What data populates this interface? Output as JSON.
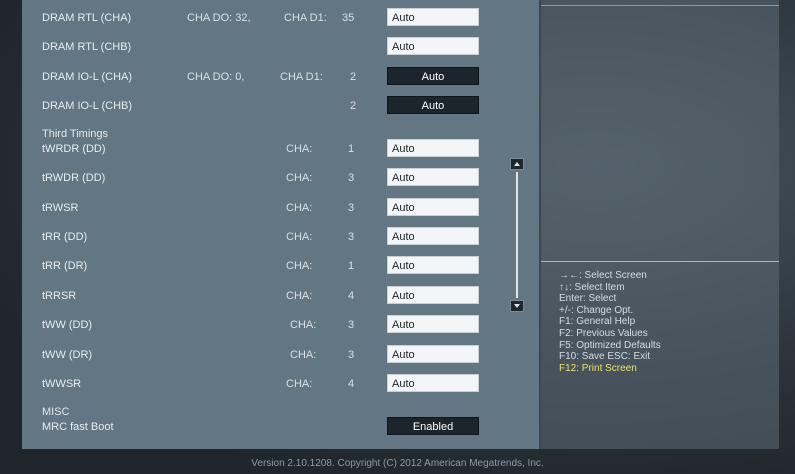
{
  "rows_top": [
    {
      "label": "DRAM RTL (CHA)",
      "cha": "CHA DO: 32,",
      "chb": "CHA D1:",
      "num": "35",
      "value": "Auto",
      "style": "light"
    },
    {
      "label": "DRAM RTL (CHB)",
      "cha": "",
      "chb": "",
      "num": "",
      "value": "Auto",
      "style": "light"
    },
    {
      "label": "DRAM IO-L (CHA)",
      "cha": "CHA DO: 0,",
      "chb": "CHA D1:",
      "num": "2",
      "value": "Auto",
      "style": "dark"
    },
    {
      "label": "DRAM IO-L (CHB)",
      "cha": "",
      "chb": "",
      "num": "2",
      "value": "Auto",
      "style": "dark"
    }
  ],
  "third_timings_title": "Third Timings",
  "timings": [
    {
      "label": "tWRDR (DD)",
      "ch": "CHA:",
      "num": "1",
      "value": "Auto"
    },
    {
      "label": "tRWDR (DD)",
      "ch": "CHA:",
      "num": "3",
      "value": "Auto"
    },
    {
      "label": "tRWSR",
      "ch": "CHA:",
      "num": "3",
      "value": "Auto"
    },
    {
      "label": "tRR (DD)",
      "ch": "CHA:",
      "num": "3",
      "value": "Auto"
    },
    {
      "label": "tRR (DR)",
      "ch": "CHA:",
      "num": "1",
      "value": "Auto"
    },
    {
      "label": "tRRSR",
      "ch": "CHA:",
      "num": "4",
      "value": "Auto"
    },
    {
      "label": "tWW (DD)",
      "ch": "CHA:",
      "num": "3",
      "value": "Auto"
    },
    {
      "label": "tWW (DR)",
      "ch": "CHA:",
      "num": "3",
      "value": "Auto"
    },
    {
      "label": "tWWSR",
      "ch": "CHA:",
      "num": "4",
      "value": "Auto"
    }
  ],
  "misc_title": "MISC",
  "mrc": {
    "label": "MRC fast Boot",
    "value": "Enabled"
  },
  "help": {
    "select_screen": "→←: Select Screen",
    "select_item": "↑↓: Select Item",
    "enter": "Enter: Select",
    "change": "+/-: Change Opt.",
    "f1": "F1: General Help",
    "f2": "F2: Previous Values",
    "f5": "F5: Optimized Defaults",
    "f10": "F10: Save   ESC: Exit",
    "f12": "F12: Print Screen"
  },
  "footer": "Version  2.10.1208.  Copyright  (C)  2012  American  Megatrends,  Inc.",
  "colors": {
    "panel": "#627683",
    "highlight": "#f1e06a",
    "dark_field": "#1d252c"
  }
}
